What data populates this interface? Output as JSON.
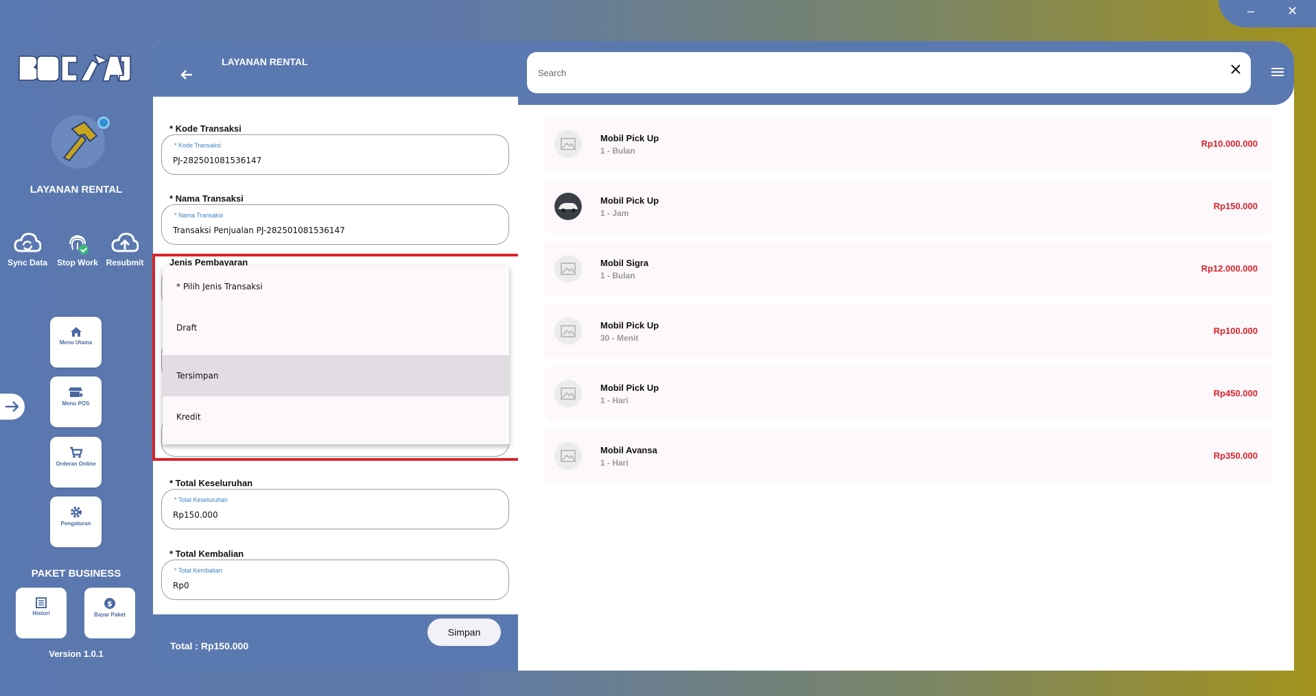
{
  "window": {
    "minimize": "–",
    "close": "✕"
  },
  "sidebar": {
    "app_title": "LAYANAN RENTAL",
    "actions": [
      {
        "label": "Sync Data",
        "icon": "cloud-sync-icon"
      },
      {
        "label": "Stop Work",
        "icon": "fingerprint-icon"
      },
      {
        "label": "Resubmit",
        "icon": "cloud-upload-icon"
      }
    ],
    "menu": [
      {
        "label": "Menu Utama",
        "icon": "home-icon"
      },
      {
        "label": "Menu POS",
        "icon": "store-icon"
      },
      {
        "label": "Orderan Online",
        "icon": "cart-icon"
      },
      {
        "label": "Pengaturan",
        "icon": "gear-icon"
      }
    ],
    "package_title": "PAKET BUSINESS",
    "package_buttons": [
      {
        "label": "Histori",
        "icon": "history-icon"
      },
      {
        "label": "Bayar Paket",
        "icon": "dollar-icon"
      }
    ],
    "version": "Version 1.0.1"
  },
  "form": {
    "header_title": "LAYANAN RENTAL",
    "fields": {
      "kode": {
        "label": "* Kode Transaksi",
        "floating": "* Kode Transaksi",
        "value": "PJ-282501081536147"
      },
      "nama": {
        "label": "* Nama Transaksi",
        "floating": "* Nama Transaksi",
        "value": "Transaksi Penjualan PJ-282501081536147"
      },
      "jenis": {
        "label": "Jenis Pembayaran"
      },
      "total": {
        "label": "* Total Keseluruhan",
        "floating": "* Total Keseluruhan",
        "value": "Rp150.000"
      },
      "kembalian": {
        "label": "* Total Kembalian",
        "floating": "* Total Kembalian",
        "value": "Rp0"
      }
    },
    "dropdown": {
      "options": [
        "* Pilih Jenis Transaksi",
        "Draft",
        "Tersimpan",
        "Kredit"
      ],
      "selected": "Tersimpan"
    },
    "footer": {
      "total": "Total :  Rp150.000",
      "save_label": "Simpan"
    }
  },
  "search": {
    "placeholder": "Search",
    "value": ""
  },
  "products": [
    {
      "name": "Mobil Pick Up",
      "duration": "1 - Bulan",
      "price": "Rp10.000.000",
      "thumb": "placeholder"
    },
    {
      "name": "Mobil Pick Up",
      "duration": "1 - Jam",
      "price": "Rp150.000",
      "thumb": "car-photo"
    },
    {
      "name": "Mobil Sigra",
      "duration": "1 - Bulan",
      "price": "Rp12.000.000",
      "thumb": "placeholder"
    },
    {
      "name": "Mobil Pick Up",
      "duration": "30 - Menit",
      "price": "Rp100.000",
      "thumb": "placeholder"
    },
    {
      "name": "Mobil Pick Up",
      "duration": "1 - Hari",
      "price": "Rp450.000",
      "thumb": "placeholder"
    },
    {
      "name": "Mobil Avansa",
      "duration": "1 - Hari",
      "price": "Rp350.000",
      "thumb": "placeholder"
    }
  ],
  "colors": {
    "primary": "#5b79b1",
    "accent_red": "#d9232a",
    "price_red": "#d9232a"
  }
}
